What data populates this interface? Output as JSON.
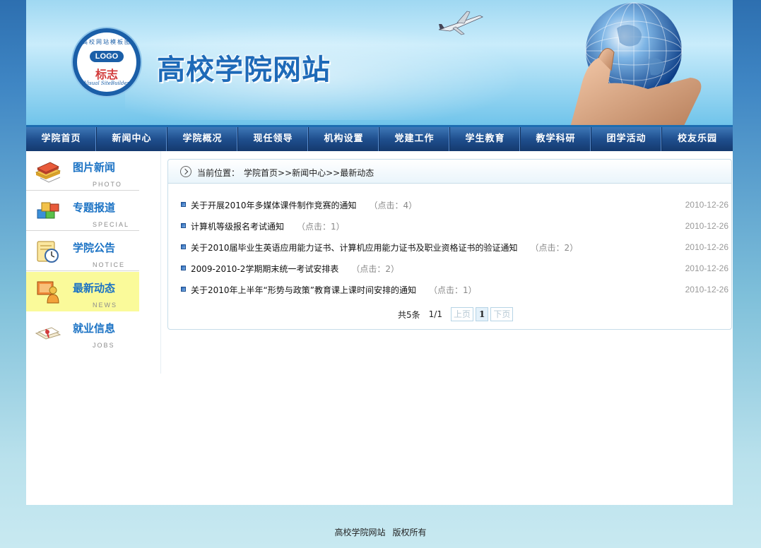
{
  "banner": {
    "site_title": "高校学院网站",
    "logo_ring_top": "高校网站模板图",
    "logo_main": "LOGO",
    "logo_sub": "标志",
    "logo_ring_bottom": "Visual SiteBuilder"
  },
  "nav": [
    "学院首页",
    "新闻中心",
    "学院概况",
    "现任领导",
    "机构设置",
    "党建工作",
    "学生教育",
    "教学科研",
    "团学活动",
    "校友乐园"
  ],
  "sidebar": [
    {
      "title": "图片新闻",
      "en": "PHOTO",
      "icon": "books-icon",
      "active": false
    },
    {
      "title": "专题报道",
      "en": "SPECIAL",
      "icon": "blocks-icon",
      "active": false
    },
    {
      "title": "学院公告",
      "en": "NOTICE",
      "icon": "clock-icon",
      "active": false
    },
    {
      "title": "最新动态",
      "en": "NEWS",
      "icon": "person-icon",
      "active": true
    },
    {
      "title": "就业信息",
      "en": "JOBS",
      "icon": "diploma-icon",
      "active": false
    }
  ],
  "breadcrumb": {
    "label": "当前位置：",
    "path": "学院首页>>新闻中心>>最新动态"
  },
  "news": [
    {
      "title": "关于开展2010年多媒体课件制作竞赛的通知",
      "clicks": "（点击：4）",
      "date": "2010-12-26"
    },
    {
      "title": "计算机等级报名考试通知",
      "clicks": "（点击：1）",
      "date": "2010-12-26"
    },
    {
      "title": "关于2010届毕业生英语应用能力证书、计算机应用能力证书及职业资格证书的验证通知",
      "clicks": "（点击：2）",
      "date": "2010-12-26"
    },
    {
      "title": "2009-2010-2学期期末统一考试安排表",
      "clicks": "（点击：2）",
      "date": "2010-12-26"
    },
    {
      "title": "关于2010年上半年“形势与政策”教育课上课时间安排的通知",
      "clicks": "（点击：1）",
      "date": "2010-12-26"
    }
  ],
  "pager": {
    "total": "共5条",
    "page_info": "1/1",
    "prev": "上页",
    "current": "1",
    "next": "下页"
  },
  "footer": {
    "site": "高校学院网站",
    "rights": "版权所有"
  }
}
